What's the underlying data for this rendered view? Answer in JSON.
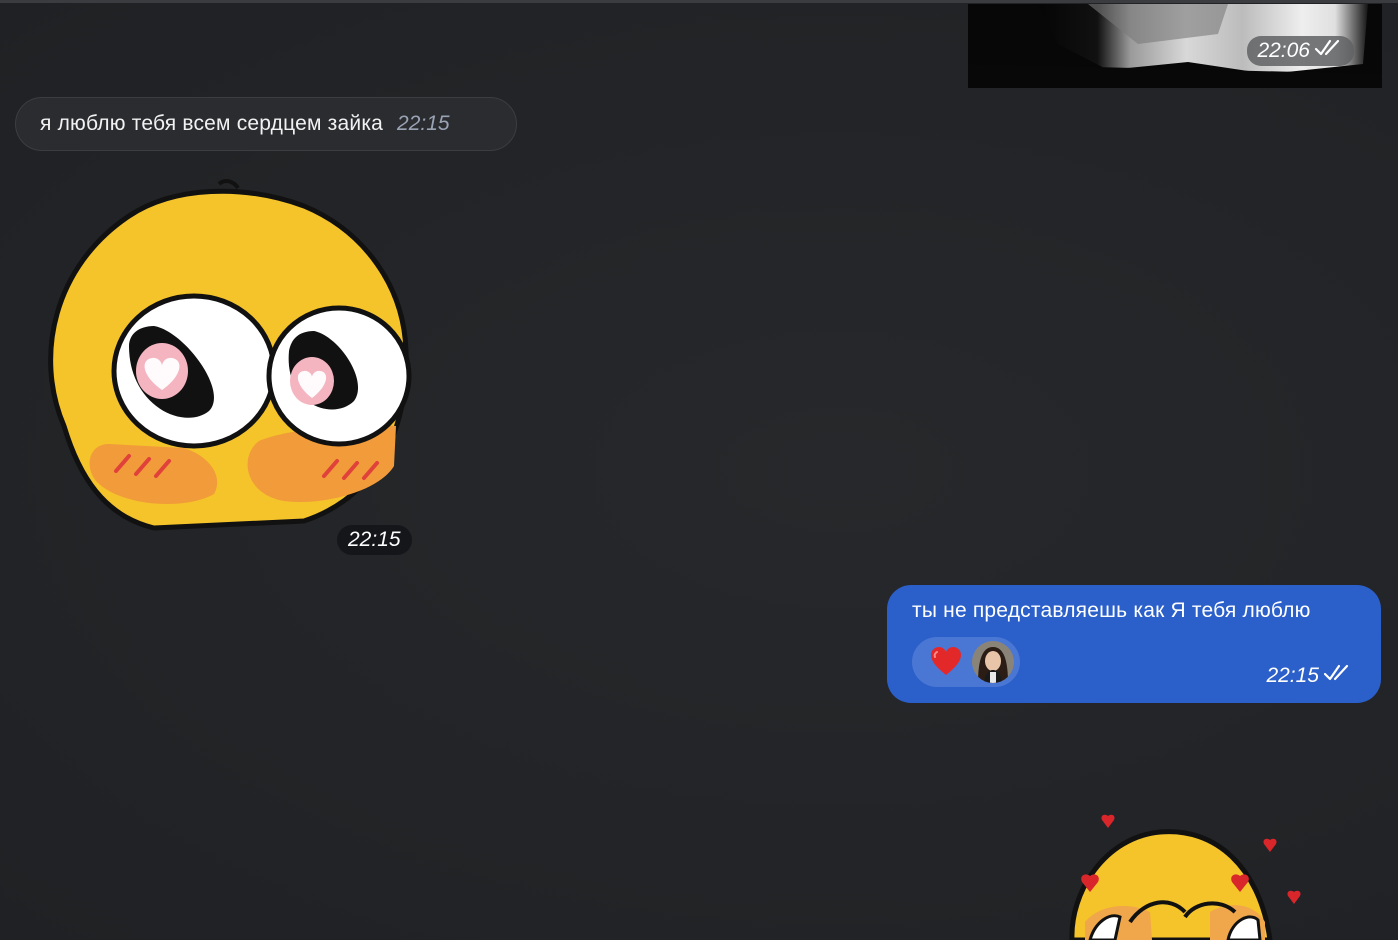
{
  "chat": {
    "media_message": {
      "time": "22:06",
      "status": "read"
    },
    "incoming_message": {
      "text": "я люблю тебя всем сердцем зайка",
      "time": "22:15"
    },
    "sticker_message": {
      "time": "22:15"
    },
    "outgoing_message": {
      "text": "ты не представляешь как Я тебя люблю",
      "time": "22:15",
      "status": "read",
      "reaction": {
        "emoji": "heart-icon"
      }
    }
  },
  "colors": {
    "background": "#232528",
    "incoming_bubble": "#2a2c30",
    "outgoing_bubble": "#2b5fc9",
    "reaction_pill": "#4a77d3",
    "time_incoming": "#9aa3b4"
  }
}
